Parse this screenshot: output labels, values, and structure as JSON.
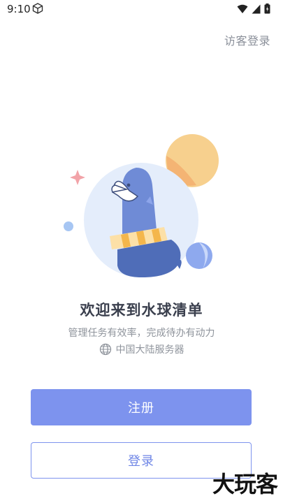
{
  "status_bar": {
    "time": "9:10"
  },
  "header": {
    "guest_login": "访客登录"
  },
  "welcome": {
    "title": "欢迎来到水球清单",
    "subtitle": "管理任务有效率，完成待办有动力",
    "server": "中国大陆服务器"
  },
  "actions": {
    "register": "注册",
    "login": "登录"
  },
  "watermark": "大玩客",
  "colors": {
    "accent": "#7d93ee",
    "title": "#3a3f4d",
    "muted": "#8f949c"
  },
  "icons": [
    "box-icon",
    "wifi-icon",
    "signal-icon",
    "battery-icon",
    "globe-icon"
  ]
}
